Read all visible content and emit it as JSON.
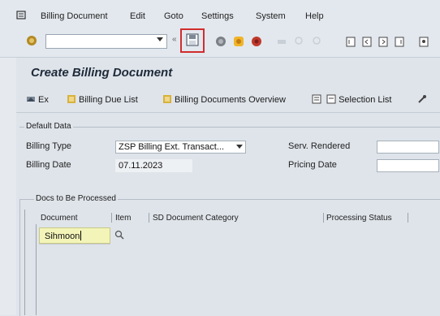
{
  "menu": {
    "items": [
      "Billing Document",
      "Edit",
      "Goto",
      "Settings",
      "System",
      "Help"
    ]
  },
  "toolbar": {
    "command_field_value": "",
    "icons": [
      "check-icon",
      "save-icon",
      "back-icon",
      "exit-icon",
      "cancel-icon",
      "print-icon",
      "find-icon",
      "find-next-icon",
      "first-page-icon",
      "prev-page-icon",
      "next-page-icon",
      "last-page-icon"
    ]
  },
  "page": {
    "title": "Create Billing Document"
  },
  "app_toolbar": {
    "execute": "Ex",
    "billing_due_list": "Billing Due List",
    "billing_documents_overview": "Billing Documents Overview",
    "selection_list": "Selection List"
  },
  "default_data": {
    "group_title": "Default Data",
    "billing_type_label": "Billing Type",
    "billing_type_value": "ZSP Billing Ext. Transact...",
    "billing_date_label": "Billing Date",
    "billing_date_value": "07.11.2023",
    "serv_rendered_label": "Serv. Rendered",
    "serv_rendered_value": "",
    "pricing_date_label": "Pricing Date",
    "pricing_date_value": ""
  },
  "docs_to_process": {
    "group_title": "Docs to Be Processed",
    "columns": [
      "Document",
      "Item",
      "SD Document Category",
      "Processing Status"
    ],
    "rows": [
      {
        "document": "Sihmoon",
        "item": ""
      }
    ]
  },
  "colors": {
    "accent_highlight": "#d12d2d",
    "entry_cell": "#f3f4b8",
    "background": "#dfe4ea"
  }
}
